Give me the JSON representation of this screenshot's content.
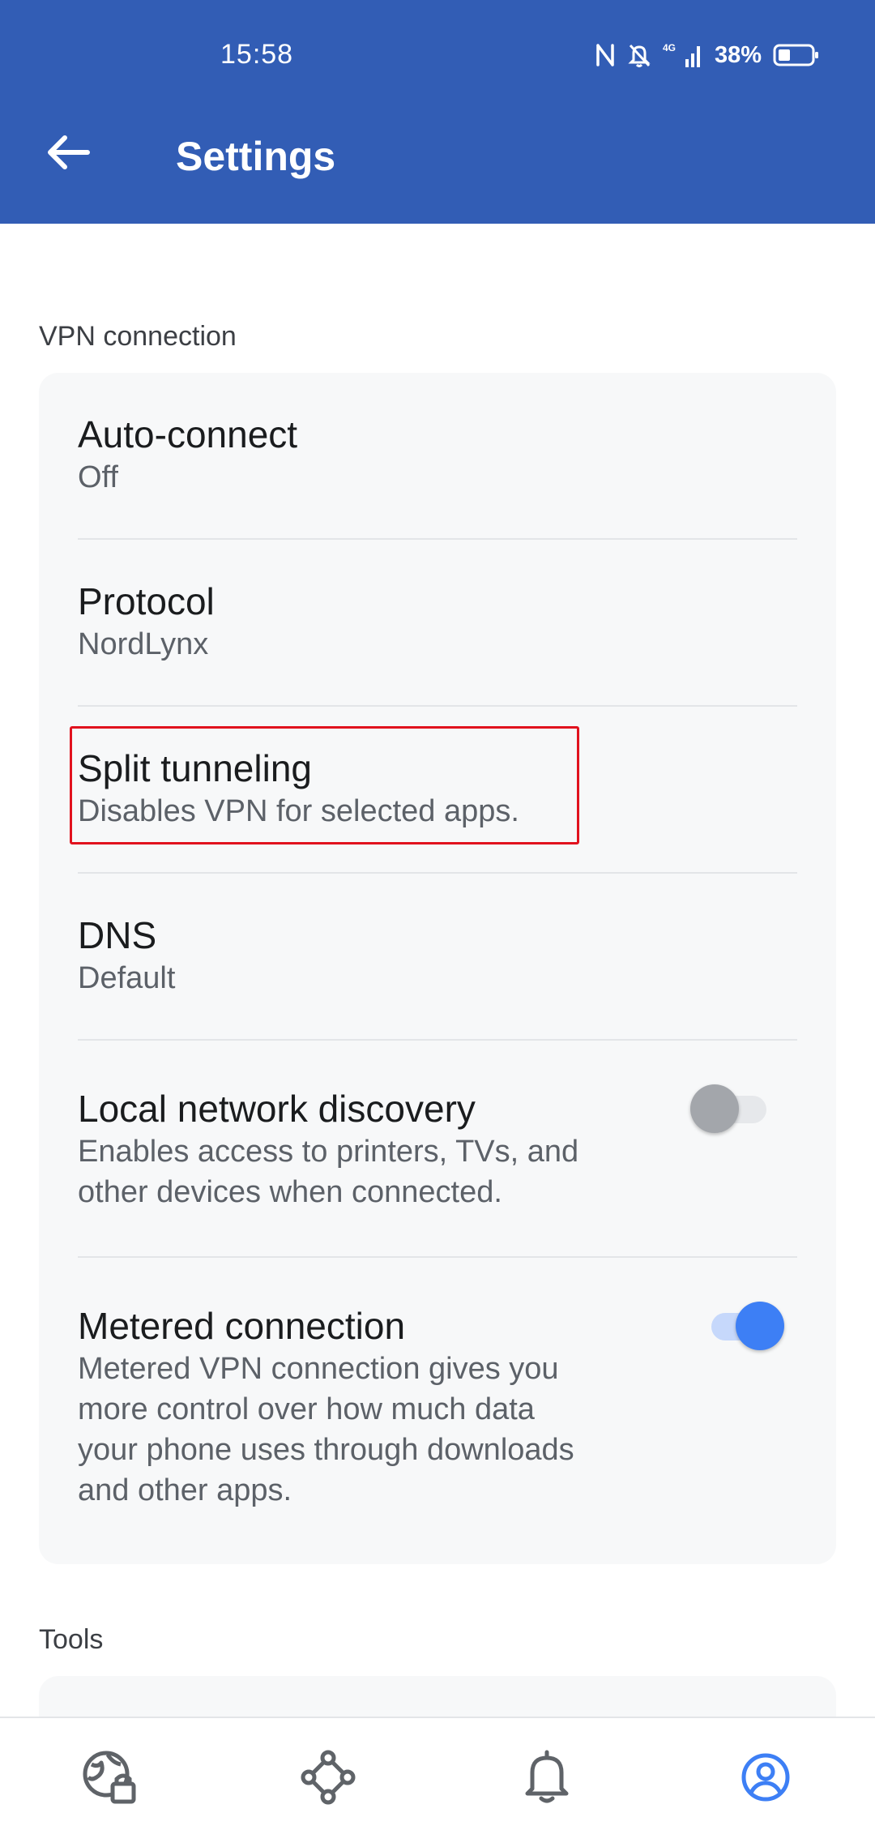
{
  "status_bar": {
    "time": "15:58",
    "network": "4G",
    "battery": "38%",
    "icons": [
      "nfc-icon",
      "bell-off-icon",
      "signal-icon",
      "battery-icon"
    ]
  },
  "app_bar": {
    "title": "Settings",
    "back_icon": "arrow-left-icon"
  },
  "vpn_section": {
    "title": "VPN connection",
    "items": [
      {
        "title": "Auto-connect",
        "subtitle": "Off"
      },
      {
        "title": "Protocol",
        "subtitle": "NordLynx"
      },
      {
        "title": "Split tunneling",
        "subtitle": "Disables VPN for selected apps."
      },
      {
        "title": "DNS",
        "subtitle": "Default"
      },
      {
        "title": "Local network discovery",
        "subtitle_lines": [
          "Enables access to printers, TVs, and",
          "other devices when connected."
        ],
        "toggle_on": false
      },
      {
        "title": "Metered connection",
        "subtitle_lines": [
          "Metered VPN connection gives you",
          "more control over how much data",
          "your phone uses through downloads",
          "and other apps."
        ],
        "toggle_on": true
      }
    ]
  },
  "tools_section": {
    "title": "Tools"
  },
  "bottom_nav": {
    "items": [
      {
        "icon": "globe-lock-icon",
        "active": false
      },
      {
        "icon": "meshnet-icon",
        "active": false
      },
      {
        "icon": "bell-icon",
        "active": false
      },
      {
        "icon": "profile-icon",
        "active": true
      }
    ]
  },
  "colors": {
    "app_bar": "#325db5",
    "card_background": "#f7f8f9",
    "accent": "#3d7ff5",
    "toggle_off_thumb": "#a3a6ab",
    "highlight_border": "#e1121e",
    "nav_inactive": "#5f6368"
  }
}
